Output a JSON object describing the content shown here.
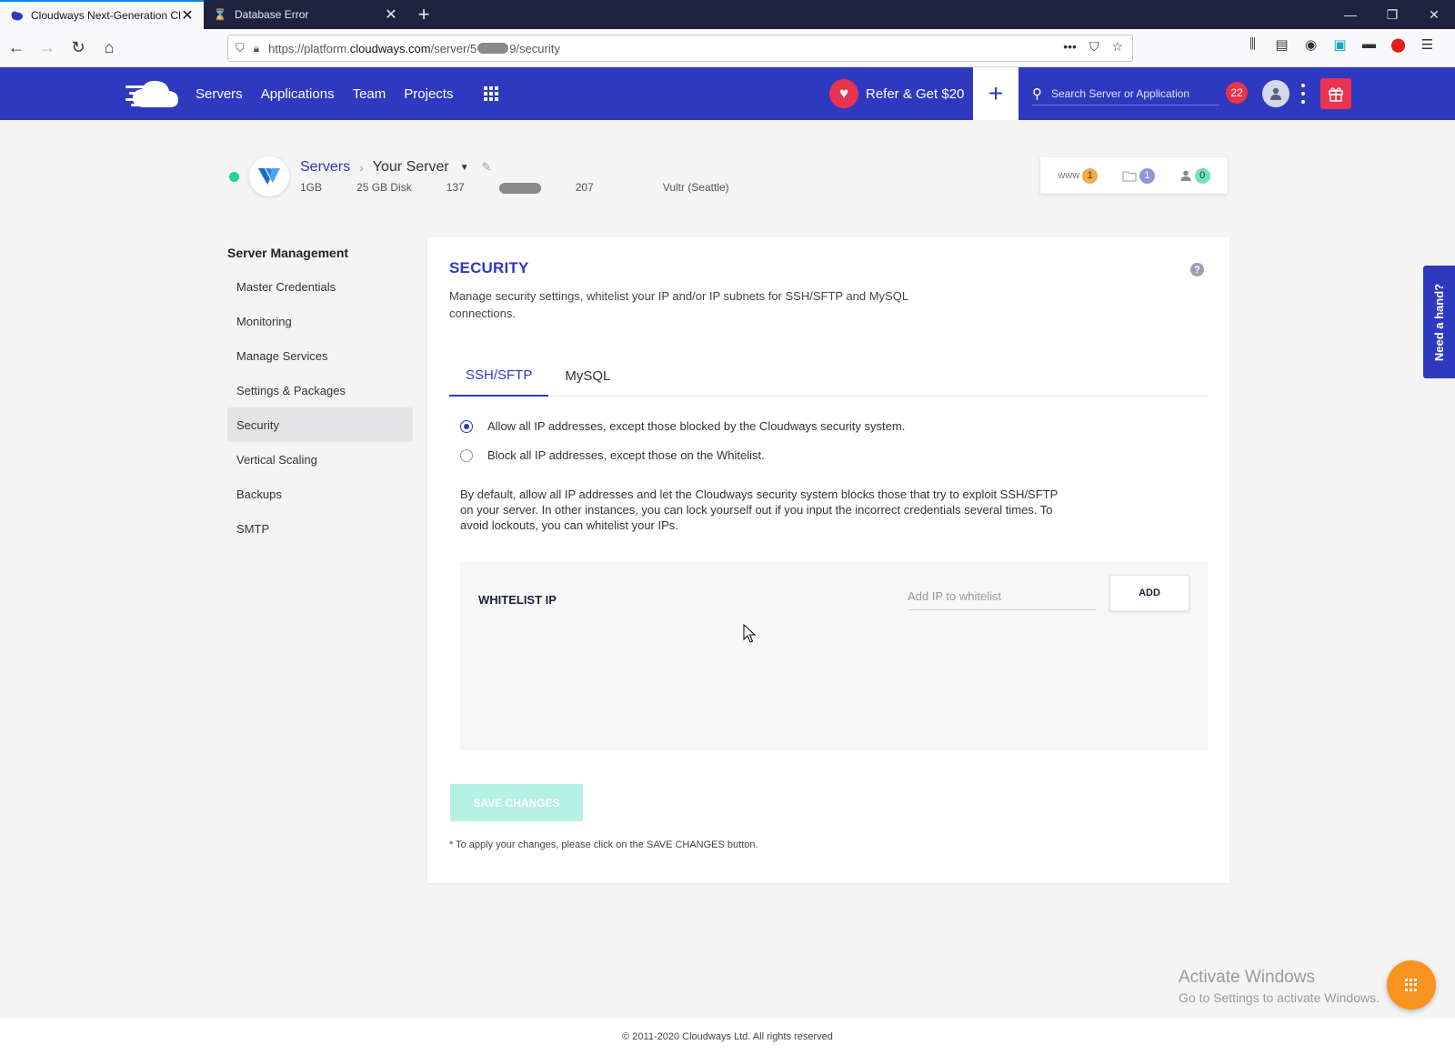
{
  "browser": {
    "tabs": [
      {
        "title": "Cloudways Next-Generation Cl",
        "active": true,
        "favicon": "cloudways-favicon"
      },
      {
        "title": "Database Error",
        "active": false,
        "favicon": "hourglass-icon"
      }
    ],
    "url": {
      "prefix": "https://platform.",
      "host": "cloudways.com",
      "path_start": "/server/5",
      "path_end": "9/security"
    }
  },
  "header": {
    "nav": [
      "Servers",
      "Applications",
      "Team",
      "Projects"
    ],
    "refer_label": "Refer & Get $20",
    "search_placeholder": "Search Server or Application",
    "notification_count": "22",
    "brand_color": "#2f39bf",
    "accent_color": "#e8344e"
  },
  "server": {
    "breadcrumb_root": "Servers",
    "name": "Your Server",
    "ram": "1GB",
    "disk": "25 GB Disk",
    "ip_start": "137",
    "ip_end": "207",
    "provider": "Vultr (Seattle)",
    "counters": [
      {
        "label": "www",
        "count": "1",
        "color": "#f7a84a"
      },
      {
        "icon": "folder-icon",
        "count": "1",
        "color": "#8f96d6"
      },
      {
        "icon": "user-icon",
        "count": "0",
        "color": "#6fe3c4"
      }
    ]
  },
  "sidebar": {
    "title": "Server Management",
    "items": [
      {
        "label": "Master Credentials",
        "active": false
      },
      {
        "label": "Monitoring",
        "active": false
      },
      {
        "label": "Manage Services",
        "active": false
      },
      {
        "label": "Settings & Packages",
        "active": false
      },
      {
        "label": "Security",
        "active": true
      },
      {
        "label": "Vertical Scaling",
        "active": false
      },
      {
        "label": "Backups",
        "active": false
      },
      {
        "label": "SMTP",
        "active": false
      }
    ]
  },
  "security": {
    "title": "SECURITY",
    "description": "Manage security settings, whitelist your IP and/or IP subnets for SSH/SFTP and MySQL connections.",
    "tabs": [
      {
        "label": "SSH/SFTP",
        "active": true
      },
      {
        "label": "MySQL",
        "active": false
      }
    ],
    "options": [
      {
        "label": "Allow all IP addresses, except those blocked by the Cloudways security system.",
        "checked": true
      },
      {
        "label": "Block all IP addresses, except those on the Whitelist.",
        "checked": false
      }
    ],
    "explanation": "By default, allow all IP addresses and let the Cloudways security system blocks those that try to exploit SSH/SFTP on your server. In other instances, you can lock yourself out if you input the incorrect credentials several times. To avoid lockouts, you can whitelist your IPs.",
    "whitelist": {
      "title": "WHITELIST IP",
      "placeholder": "Add IP to whitelist",
      "value": "",
      "add_label": "ADD"
    },
    "save_label": "SAVE CHANGES",
    "save_note": "* To apply your changes, please click on the SAVE CHANGES button."
  },
  "help_tab": "Need a hand?",
  "watermark": {
    "line1": "Activate Windows",
    "line2": "Go to Settings to activate Windows."
  },
  "footer": "© 2011-2020 Cloudways Ltd. All rights reserved"
}
